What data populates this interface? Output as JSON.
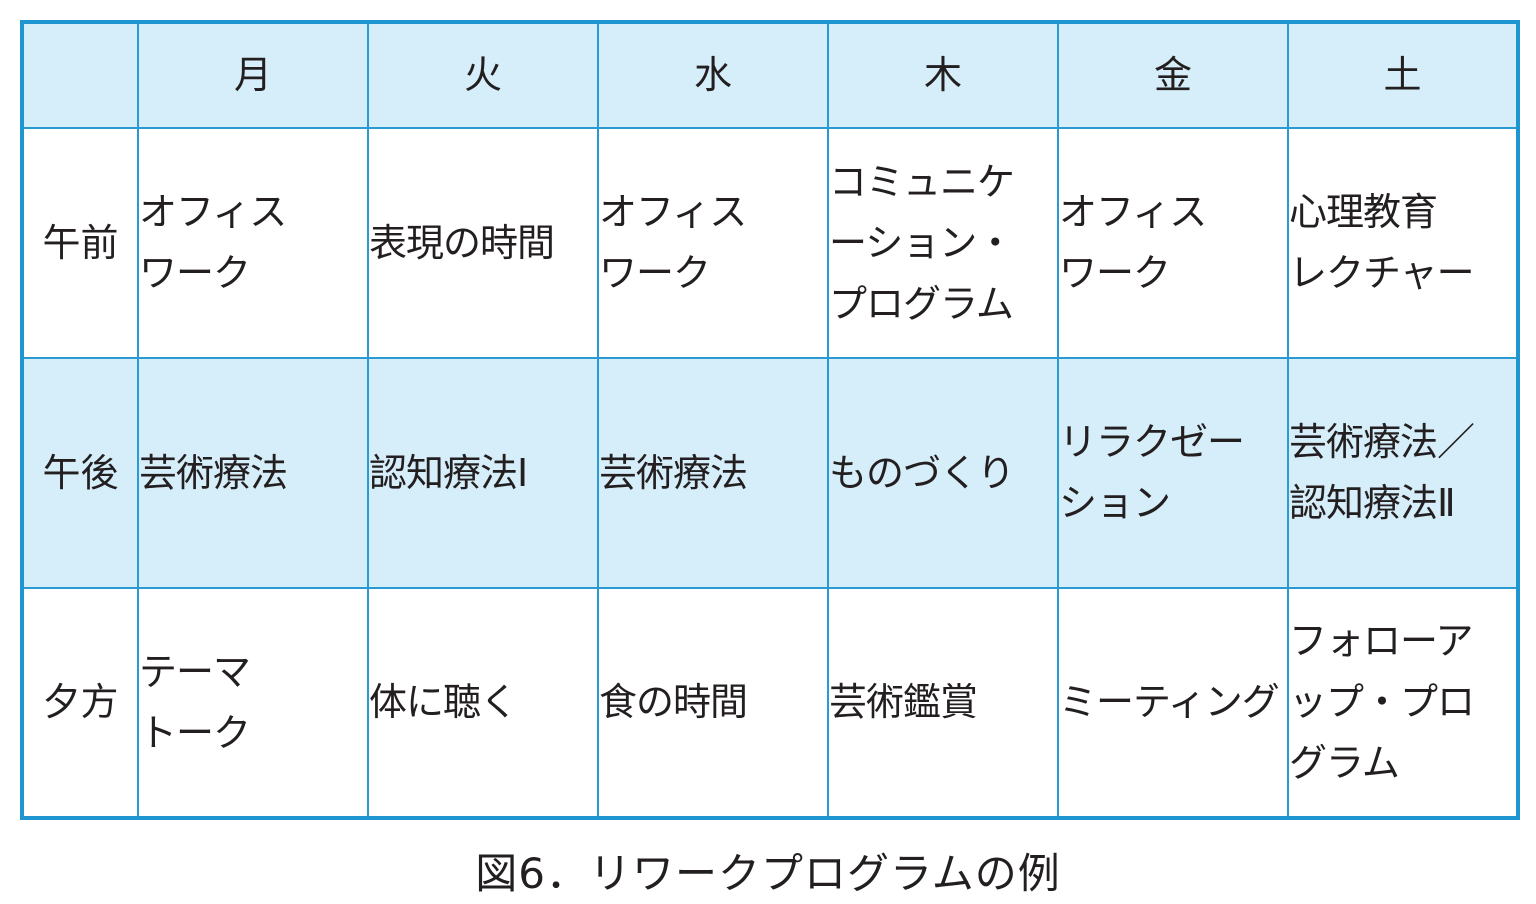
{
  "table": {
    "days": [
      "月",
      "火",
      "水",
      "木",
      "金",
      "土"
    ],
    "rows": [
      {
        "period": "午前",
        "cells": [
          "オフィス\nワーク",
          "表現の時間",
          "オフィス\nワーク",
          "コミュニケ\nーション・\nプログラム",
          "オフィス\nワーク",
          "心理教育\nレクチャー"
        ]
      },
      {
        "period": "午後",
        "cells": [
          "芸術療法",
          "認知療法Ⅰ",
          "芸術療法",
          "ものづくり",
          "リラクゼー\nション",
          "芸術療法／\n認知療法Ⅱ"
        ]
      },
      {
        "period": "夕方",
        "cells": [
          "テーマ\nトーク",
          "体に聴く",
          "食の時間",
          "芸術鑑賞",
          "ミーティング",
          "フォローア\nップ・プロ\nグラム"
        ]
      }
    ]
  },
  "caption": "図6．リワークプログラムの例",
  "colors": {
    "border": "#1f96cf",
    "shade": "#d6eef9"
  }
}
